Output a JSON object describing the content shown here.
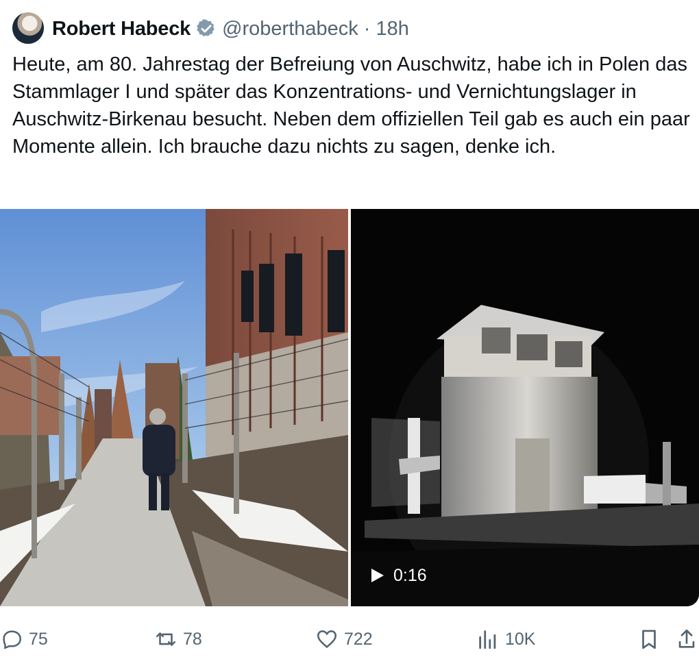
{
  "tweet": {
    "author_name": "Robert Habeck",
    "handle": "@roberthabeck",
    "separator": "·",
    "time": "18h",
    "text": "Heute, am 80. Jahrestag der Befreiung von Auschwitz, habe ich in Polen das Stammlager I und später das Konzentrations- und Vernichtungslager in Auschwitz-Birkenau besucht. Neben dem offiziellen Teil gab es auch ein paar Momente allein. Ich brauche dazu nichts zu sagen, denke ich."
  },
  "media": {
    "video_duration": "0:16"
  },
  "actions": {
    "replies": "75",
    "reposts": "78",
    "likes": "722",
    "views": "10K"
  },
  "colors": {
    "text": "#0f1419",
    "secondary": "#536471",
    "verified_badge": "#829aab"
  },
  "icons": [
    "verified-badge-icon",
    "play-icon",
    "reply-icon",
    "repost-icon",
    "like-icon",
    "views-icon",
    "bookmark-icon",
    "share-icon"
  ]
}
